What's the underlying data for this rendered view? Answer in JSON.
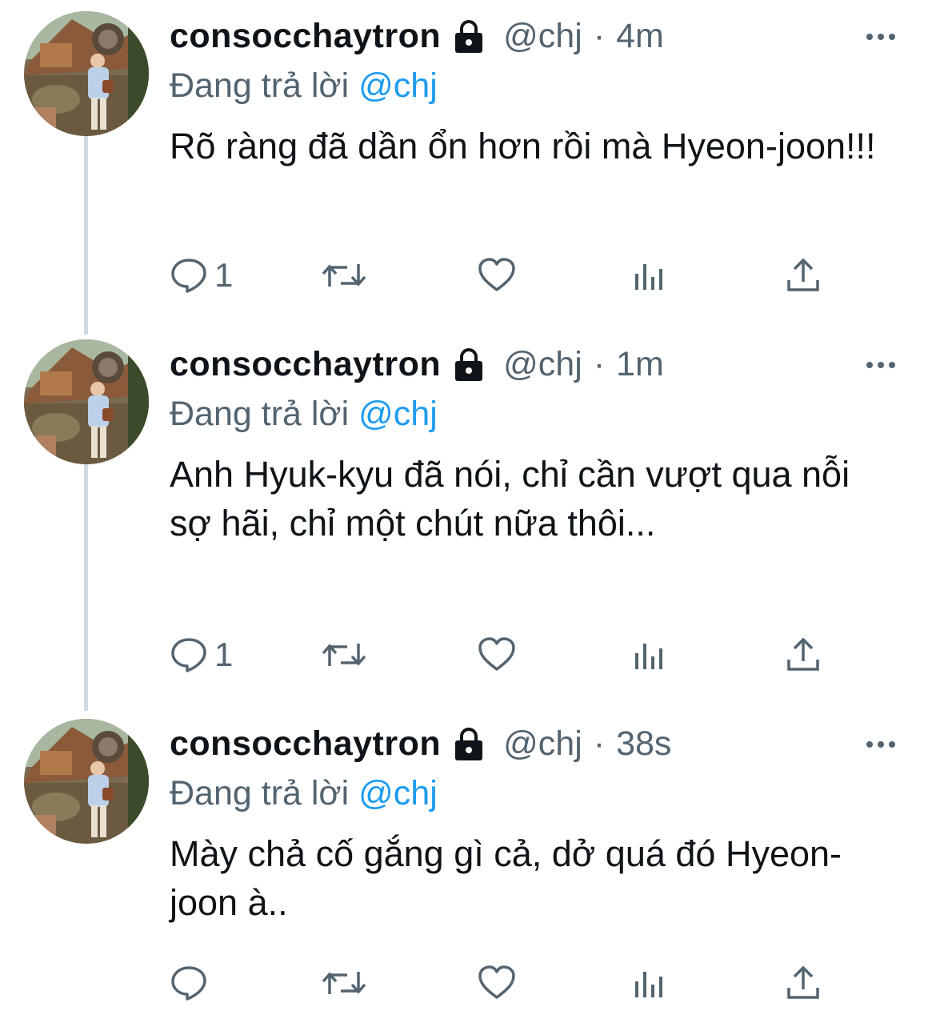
{
  "colors": {
    "text_primary": "#0f1419",
    "text_secondary": "#536471",
    "accent": "#1d9bf0",
    "thread_line": "#cfd9de"
  },
  "icons": {
    "lock": "lock-icon",
    "more": "more-horizontal-icon",
    "reply": "reply-bubble-icon",
    "retweet": "retweet-icon",
    "like": "heart-icon",
    "views": "bar-chart-icon",
    "share": "share-upload-icon"
  },
  "tweets": [
    {
      "name": "consocchaytron",
      "handle": "@chj",
      "separator": "·",
      "time": "4m",
      "replying_label": "Đang trả lời ",
      "replying_handle": "@chj",
      "text": "Rõ ràng đã dần ổn hơn rồi mà Hyeon-joon!!!",
      "reply_count": "1"
    },
    {
      "name": "consocchaytron",
      "handle": "@chj",
      "separator": "·",
      "time": "1m",
      "replying_label": "Đang trả lời ",
      "replying_handle": "@chj",
      "text": "Anh Hyuk-kyu đã nói, chỉ cần vượt qua nỗi sợ hãi, chỉ một chút nữa thôi...",
      "reply_count": "1"
    },
    {
      "name": "consocchaytron",
      "handle": "@chj",
      "separator": "·",
      "time": "38s",
      "replying_label": "Đang trả lời ",
      "replying_handle": "@chj",
      "text": "Mày chả cố gắng gì cả, dở quá đó Hyeon-joon à..",
      "reply_count": ""
    }
  ]
}
